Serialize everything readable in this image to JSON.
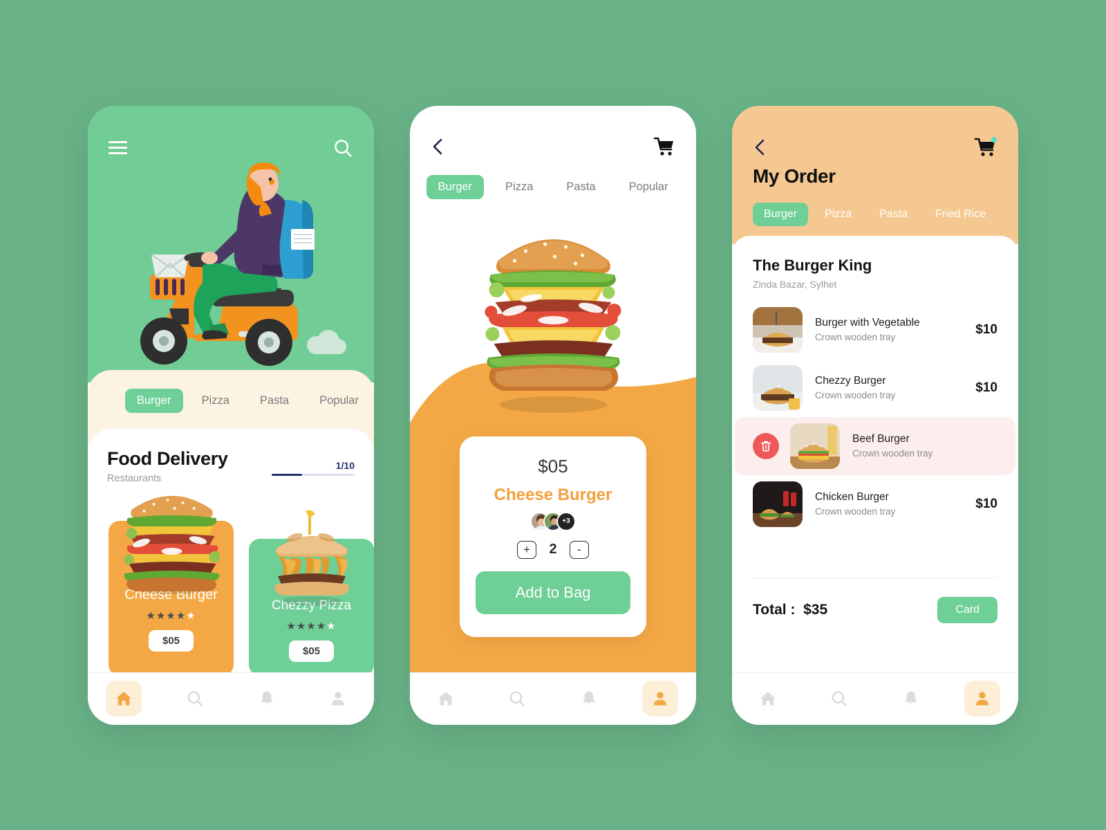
{
  "theme": {
    "page_bg": "#69b287",
    "green": "#6ecf97",
    "orange": "#f3a845",
    "cream": "#fdf3e3",
    "peach": "#f6c891",
    "red": "#ef5858",
    "navy": "#24306b"
  },
  "screen1": {
    "menu_icon": "hamburger-icon",
    "search_icon": "search-icon",
    "illustration": "delivery-scooter-illustration",
    "tabs": [
      {
        "label": "Burger",
        "active": true
      },
      {
        "label": "Pizza",
        "active": false
      },
      {
        "label": "Pasta",
        "active": false
      },
      {
        "label": "Popular",
        "active": false
      }
    ],
    "title": "Food Delivery",
    "subtitle": "Restaurants",
    "pager": "1/10",
    "cards": [
      {
        "name": "Cheese Burger",
        "price": "$05",
        "rating": 4,
        "rating_max": 5,
        "color": "orange"
      },
      {
        "name": "Chezzy Pizza",
        "price": "$05",
        "rating": 4,
        "rating_max": 5,
        "color": "green"
      }
    ],
    "nav": [
      {
        "icon": "home-icon",
        "active": true
      },
      {
        "icon": "search-icon",
        "active": false
      },
      {
        "icon": "bell-icon",
        "active": false
      },
      {
        "icon": "user-icon",
        "active": false
      }
    ]
  },
  "screen2": {
    "back_icon": "chevron-left-icon",
    "cart_icon": "cart-icon",
    "tabs": [
      {
        "label": "Burger",
        "active": true
      },
      {
        "label": "Pizza",
        "active": false
      },
      {
        "label": "Pasta",
        "active": false
      },
      {
        "label": "Popular",
        "active": false
      }
    ],
    "hero_image": "cheese-burger-photo",
    "price": "$05",
    "name": "Cheese Burger",
    "avatars_extra": "+3",
    "quantity": "2",
    "increase_label": "+",
    "decrease_label": "-",
    "add_to_bag": "Add to Bag",
    "nav": [
      {
        "icon": "home-icon",
        "active": false
      },
      {
        "icon": "search-icon",
        "active": false
      },
      {
        "icon": "bell-icon",
        "active": false
      },
      {
        "icon": "user-icon",
        "active": true
      }
    ]
  },
  "screen3": {
    "back_icon": "chevron-left-icon",
    "cart_icon": "cart-icon",
    "title": "My Order",
    "tabs": [
      {
        "label": "Burger",
        "active": true
      },
      {
        "label": "Pizza",
        "active": false
      },
      {
        "label": "Pasta",
        "active": false
      },
      {
        "label": "Fried Rice",
        "active": false
      }
    ],
    "restaurant": "The Burger King",
    "address": "Zinda Bazar, Sylhet",
    "items": [
      {
        "name": "Burger with Vegetable",
        "sub": "Crown wooden tray",
        "price": "$10",
        "highlighted": false
      },
      {
        "name": "Chezzy Burger",
        "sub": "Crown wooden tray",
        "price": "$10",
        "highlighted": false
      },
      {
        "name": "Beef Burger",
        "sub": "Crown wooden tray",
        "price": "",
        "highlighted": true
      },
      {
        "name": "Chicken Burger",
        "sub": "Crown wooden tray",
        "price": "$10",
        "highlighted": false
      }
    ],
    "total_label": "Total :",
    "total_value": "$35",
    "pay_label": "Card",
    "nav": [
      {
        "icon": "home-icon",
        "active": false
      },
      {
        "icon": "search-icon",
        "active": false
      },
      {
        "icon": "bell-icon",
        "active": false
      },
      {
        "icon": "user-icon",
        "active": true
      }
    ]
  }
}
